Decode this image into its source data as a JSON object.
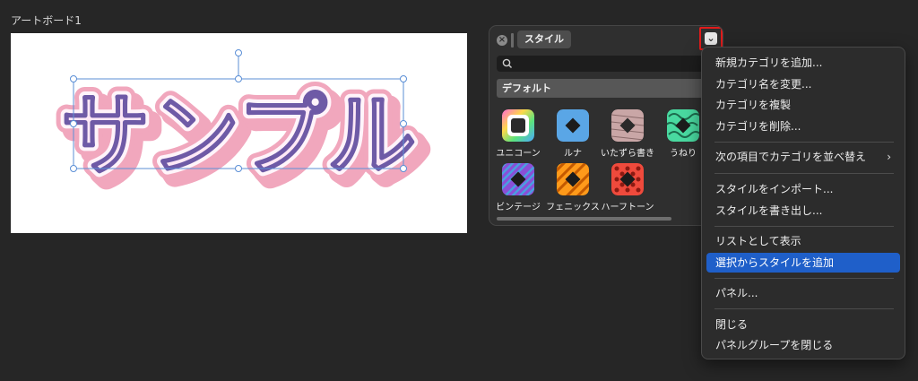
{
  "artboard": {
    "label": "アートボード1",
    "sample_text": "サンプル"
  },
  "panel": {
    "tab_label": "スタイル",
    "close_icon": "close-icon",
    "dropdown_icon": "chevron-down-icon",
    "search_placeholder": "",
    "category": "デフォルト",
    "styles": [
      {
        "label": "ユニコーン",
        "icon": "unicorn-style-icon"
      },
      {
        "label": "ルナ",
        "icon": "luna-style-icon"
      },
      {
        "label": "いたずら書き",
        "icon": "doodle-style-icon"
      },
      {
        "label": "うねり",
        "icon": "swirl-style-icon"
      },
      {
        "label": "ビンテージ",
        "icon": "vintage-style-icon"
      },
      {
        "label": "フェニックス",
        "icon": "phoenix-style-icon"
      },
      {
        "label": "ハーフトーン",
        "icon": "halftone-style-icon"
      }
    ]
  },
  "menu": {
    "items": [
      {
        "label": "新規カテゴリを追加..."
      },
      {
        "label": "カテゴリ名を変更..."
      },
      {
        "label": "カテゴリを複製"
      },
      {
        "label": "カテゴリを削除..."
      },
      {
        "label": "次の項目でカテゴリを並べ替え",
        "submenu": true
      },
      {
        "label": "スタイルをインポート..."
      },
      {
        "label": "スタイルを書き出し..."
      },
      {
        "label": "リストとして表示"
      },
      {
        "label": "選択からスタイルを追加",
        "selected": true
      },
      {
        "label": "パネル..."
      },
      {
        "label": "閉じる"
      },
      {
        "label": "パネルグループを閉じる"
      }
    ]
  },
  "colors": {
    "background": "#262626",
    "highlight": "#1f5fc9",
    "callout_red": "#e21b1b",
    "text_fill": "#fde8f6",
    "text_outline_pink": "#f1a7bd",
    "text_stroke_purple": "#6e5aa6",
    "selection_blue": "#5b8fd6"
  }
}
